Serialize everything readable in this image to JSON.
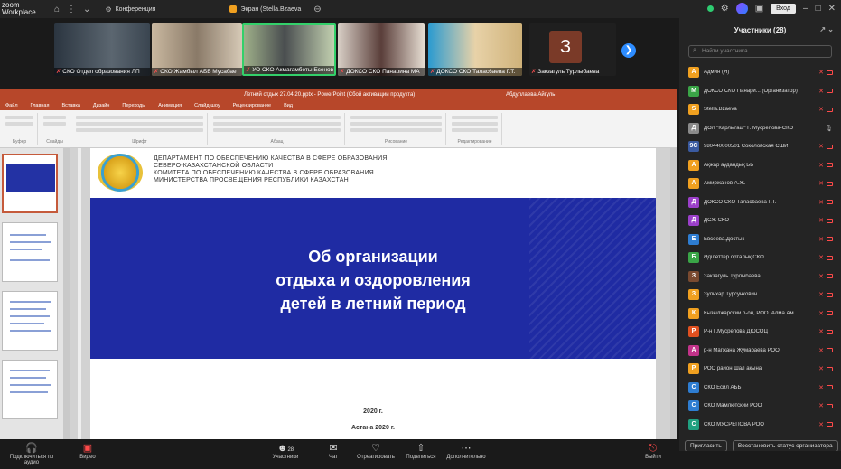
{
  "topbar": {
    "brand_line1": "zoom",
    "brand_line2": "Workplace",
    "tabs": [
      "Конференция",
      "Экран (Stella.Bzaeva"
    ],
    "signin": "Вход"
  },
  "videos": [
    {
      "caption": "СКО Отдел образования ЛП"
    },
    {
      "caption": "СКО Жамбыл АББ Мусабае"
    },
    {
      "caption": "УО СКО Акмагамбеты Есенов"
    },
    {
      "caption": "ДОКСО СКО Панарина МА"
    },
    {
      "caption": "ДОКСО СКО Талас6аева Г.Т."
    },
    {
      "caption": "Закзагуль Турлыбаева",
      "initial": "З"
    }
  ],
  "ppt": {
    "window_title": "Летний отдых 27.04.20.pptx - PowerPoint (Сбой активации продукта)",
    "user": "Абдуллаева Айгуль",
    "menu": [
      "Файл",
      "Главная",
      "Вставка",
      "Дизайн",
      "Переходы",
      "Анимация",
      "Слайд-шоу",
      "Рецензирование",
      "Вид"
    ],
    "ribbon_groups": [
      "Буфер",
      "Слайды",
      "Шрифт",
      "Абзац",
      "Рисование",
      "Редактирование"
    ]
  },
  "slide": {
    "header_lines": [
      "ДЕПАРТАМЕНТ ПО ОБЕСПЕЧЕНИЮ КАЧЕСТВА В СФЕРЕ ОБРАЗОВАНИЯ",
      "СЕВЕРО-КАЗАХСТАНСКОЙ ОБЛАСТИ",
      "КОМИТЕТА ПО ОБЕСПЕЧЕНИЮ КАЧЕСТВА В СФЕРЕ ОБРАЗОВАНИЯ",
      "МИНИСТЕРСТВА ПРОСВЕЩЕНИЯ РЕСПУБЛИКИ КАЗАХСТАН"
    ],
    "title_lines": [
      "Об организации",
      "отдыха и оздоровления",
      "детей в летний период"
    ],
    "year": "2020 г.",
    "city": "Астана 2020 г."
  },
  "panel": {
    "title": "Участники (28)",
    "search_placeholder": "Найти участника",
    "participants": [
      {
        "initial": "А",
        "name": "Админ (Я)",
        "color": "#f0a020",
        "mic": "off"
      },
      {
        "initial": "М",
        "name": "ДОКСО СКО Панари... (Организатор)",
        "color": "#3aa547",
        "mic": "off"
      },
      {
        "initial": "S",
        "name": "Stella.Bzaeva",
        "color": "#f0a020",
        "mic": "off"
      },
      {
        "initial": "Д",
        "name": "ДОЛ \"Карлыгаш\" Г. Мусрепова-СКО",
        "color": "#8a8a8a",
        "mic": "on"
      },
      {
        "initial": "9С",
        "name": "980440000501 Соколовская СШИ",
        "color": "#3a5aa0",
        "mic": "off"
      },
      {
        "initial": "А",
        "name": "Ақжар аудандық ББ",
        "color": "#f0a020",
        "mic": "off"
      },
      {
        "initial": "А",
        "name": "Амиржанов А.Ж.",
        "color": "#f0a020",
        "mic": "off"
      },
      {
        "initial": "Д",
        "name": "ДОКСО СКО Таласбаева Г.Т.",
        "color": "#9b3fc9",
        "mic": "off"
      },
      {
        "initial": "Д",
        "name": "ДСЖ СКО",
        "color": "#9b3fc9",
        "mic": "off"
      },
      {
        "initial": "Е",
        "name": "Евсеева.Достык",
        "color": "#2e7dd1",
        "mic": "off"
      },
      {
        "initial": "Б",
        "name": "Әділеттер орталық СКО",
        "color": "#3aa547",
        "mic": "off"
      },
      {
        "initial": "З",
        "name": "Закзагуль Турлыбаева",
        "color": "#7a4a30",
        "mic": "off"
      },
      {
        "initial": "З",
        "name": "Зульхар Турсункович",
        "color": "#f0a020",
        "mic": "off"
      },
      {
        "initial": "К",
        "name": "Кызылжарский р-он, РОО. Алма Ам...",
        "color": "#f0a020",
        "mic": "off"
      },
      {
        "initial": "Р",
        "name": "Р-н Г.Мусрепова ДЮСОЦ",
        "color": "#e05020",
        "mic": "off"
      },
      {
        "initial": "А",
        "name": "р-н Магжана Жумабаева РОО",
        "color": "#c2338a",
        "mic": "off"
      },
      {
        "initial": "Р",
        "name": "РОО район Шал акына",
        "color": "#f0a020",
        "mic": "off"
      },
      {
        "initial": "С",
        "name": "СКО Есил АББ",
        "color": "#2e7dd1",
        "mic": "off"
      },
      {
        "initial": "С",
        "name": "СКО Мамлютский РОО",
        "color": "#2e7dd1",
        "mic": "off"
      },
      {
        "initial": "С",
        "name": "СКО МУСРЕПОВА РОО",
        "color": "#20a080",
        "mic": "off"
      }
    ],
    "invite": "Пригласить",
    "restore": "Восстановить статус организатора"
  },
  "toolbar": {
    "audio": "Подключиться по аудио",
    "video": "Видео",
    "participants": "Участники",
    "participants_count": "28",
    "chat": "Чат",
    "react": "Отреагировать",
    "share": "Поделиться",
    "more": "Дополнительно",
    "leave": "Выйти"
  }
}
